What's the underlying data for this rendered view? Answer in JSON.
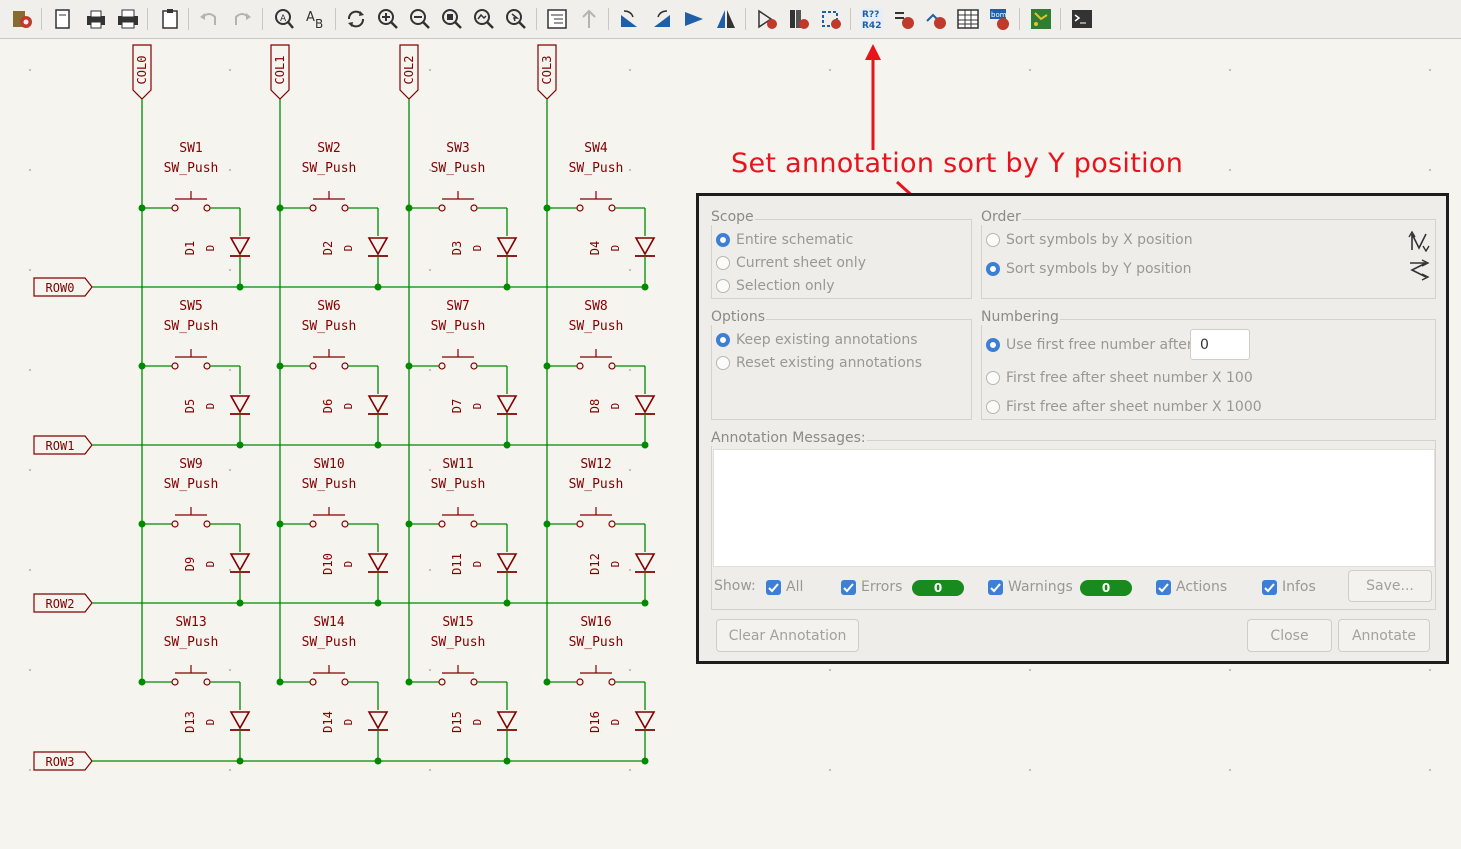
{
  "toolbar": {
    "icons": [
      "schematic-setup-icon",
      "new-sheet-icon",
      "print-icon",
      "plot-icon",
      "paste-icon",
      "undo-icon",
      "redo-icon",
      "find-icon",
      "find-replace-icon",
      "refresh-icon",
      "zoom-in-icon",
      "zoom-out-icon",
      "zoom-fit-icon",
      "zoom-objects-icon",
      "zoom-selection-icon",
      "hierarchy-icon",
      "leave-sheet-icon",
      "rotate-ccw-icon",
      "rotate-cw-icon",
      "mirror-v-icon",
      "mirror-h-icon",
      "symbol-editor-icon",
      "symbol-library-icon",
      "footprint-assign-icon",
      "annotate-icon",
      "erc-icon",
      "simulator-icon",
      "symbol-fields-table-icon",
      "bom-icon",
      "pcb-editor-icon",
      "scripting-console-icon"
    ]
  },
  "annotation_callout": "Set annotation sort by Y position",
  "schematic": {
    "columns": [
      "COL0",
      "COL1",
      "COL2",
      "COL3"
    ],
    "rows": [
      "ROW0",
      "ROW1",
      "ROW2",
      "ROW3"
    ],
    "switch_value": "SW_Push",
    "diode_value": "D",
    "switches": [
      "SW1",
      "SW2",
      "SW3",
      "SW4",
      "SW5",
      "SW6",
      "SW7",
      "SW8",
      "SW9",
      "SW10",
      "SW11",
      "SW12",
      "SW13",
      "SW14",
      "SW15",
      "SW16"
    ],
    "diodes": [
      "D1",
      "D2",
      "D3",
      "D4",
      "D5",
      "D6",
      "D7",
      "D8",
      "D9",
      "D10",
      "D11",
      "D12",
      "D13",
      "D14",
      "D15",
      "D16"
    ],
    "colors": {
      "wire": "#008a00",
      "component": "#840000",
      "junction": "#008a00",
      "background": "#f5f4ef"
    }
  },
  "dialog": {
    "scope": {
      "label": "Scope",
      "options": [
        "Entire schematic",
        "Current sheet only",
        "Selection only"
      ],
      "selected": "Entire schematic"
    },
    "order": {
      "label": "Order",
      "options": [
        "Sort symbols by X position",
        "Sort symbols by Y position"
      ],
      "selected": "Sort symbols by Y position"
    },
    "options": {
      "label": "Options",
      "options": [
        "Keep existing annotations",
        "Reset existing annotations"
      ],
      "selected": "Keep existing annotations"
    },
    "numbering": {
      "label": "Numbering",
      "options": [
        "Use first free number after:",
        "First free after sheet number X 100",
        "First free after sheet number X 1000"
      ],
      "selected": "Use first free number after:",
      "start_value": "0"
    },
    "messages": {
      "label": "Annotation Messages:",
      "show_label": "Show:",
      "filters": [
        {
          "label": "All",
          "checked": true
        },
        {
          "label": "Errors",
          "checked": true,
          "count": "0"
        },
        {
          "label": "Warnings",
          "checked": true,
          "count": "0"
        },
        {
          "label": "Actions",
          "checked": true
        },
        {
          "label": "Infos",
          "checked": true
        }
      ],
      "save_label": "Save..."
    },
    "buttons": {
      "clear": "Clear Annotation",
      "close": "Close",
      "annotate": "Annotate"
    },
    "accent": "#3d7fd5"
  }
}
